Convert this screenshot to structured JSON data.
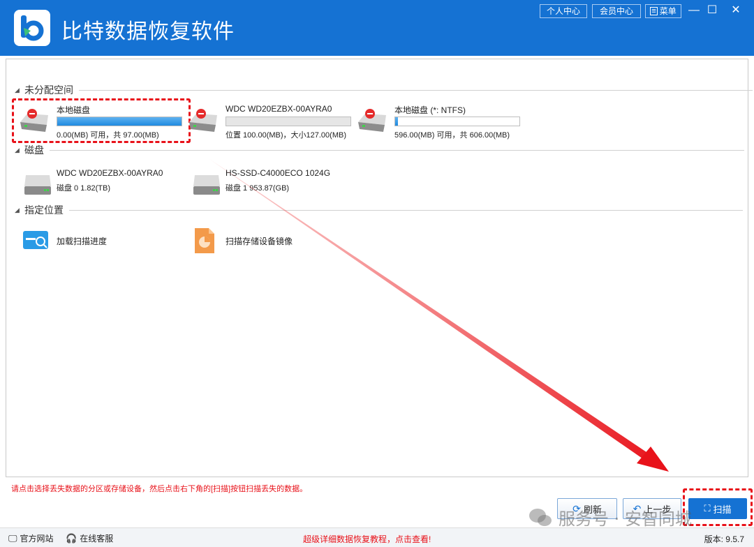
{
  "app": {
    "title": "比特数据恢复软件",
    "top_buttons": {
      "personal_center": "个人中心",
      "member_center": "会员中心",
      "menu": "菜单"
    },
    "window_controls": {
      "minimize": "—",
      "maximize": "☐",
      "close": "✕"
    }
  },
  "sections": {
    "unallocated": {
      "label": "未分配空间",
      "items": [
        {
          "name": "本地磁盘",
          "info": "0.00(MB) 可用，共 97.00(MB)",
          "fill": 1.0,
          "selected": true
        },
        {
          "name": "WDC WD20EZBX-00AYRA0",
          "info": "位置 100.00(MB)，大小127.00(MB)",
          "fill": 0.0
        },
        {
          "name": "本地磁盘 (*: NTFS)",
          "info": "596.00(MB) 可用，共 606.00(MB)",
          "fill": 0.02
        }
      ]
    },
    "disks": {
      "label": "磁盘",
      "items": [
        {
          "name": "WDC WD20EZBX-00AYRA0",
          "info": "磁盘 0    1.82(TB)"
        },
        {
          "name": "HS-SSD-C4000ECO 1024G",
          "info": "磁盘 1    953.87(GB)"
        }
      ]
    },
    "location": {
      "label": "指定位置",
      "items": [
        {
          "name": "加载扫描进度"
        },
        {
          "name": "扫描存储设备镜像"
        }
      ]
    }
  },
  "hint": "请点击选择丢失数据的分区或存储设备，然后点击右下角的[扫描]按钮扫描丢失的数据。",
  "buttons": {
    "refresh": "刷新",
    "back": "上一步",
    "scan": "扫描"
  },
  "footer": {
    "website": "官方网站",
    "support": "在线客服",
    "promo": "超级详细数据恢复教程，点击查看!",
    "version": "版本: 9.5.7"
  },
  "watermark": "服务号 · 安智同城",
  "colors": {
    "brand": "#1572d3",
    "highlight": "#e8121a"
  }
}
